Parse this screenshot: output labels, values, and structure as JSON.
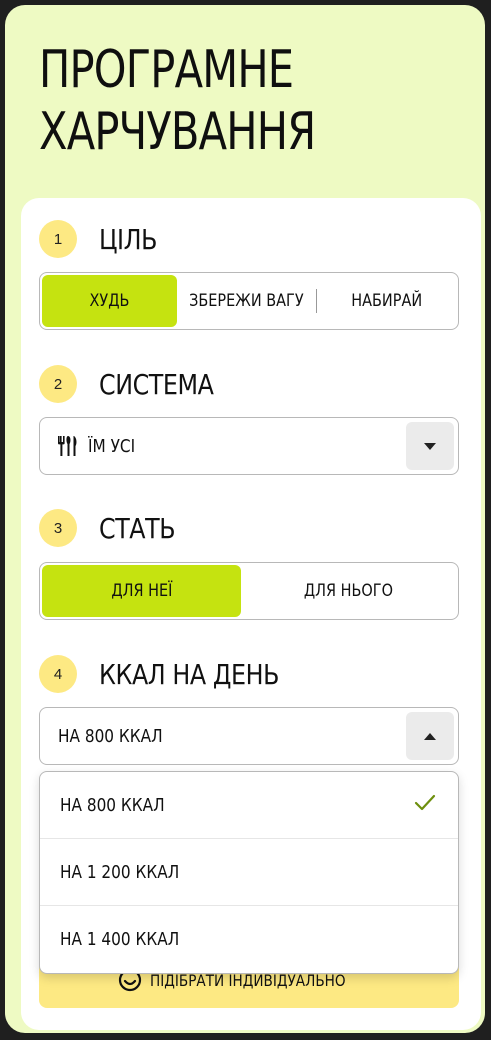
{
  "title_line1": "ПРОГРАМНЕ",
  "title_line2": "ХАРЧУВАННЯ",
  "colors": {
    "accent": "#c5e310",
    "step_badge": "#fde983",
    "background": "#eefac3"
  },
  "steps": [
    {
      "number": "1",
      "title": "ЦІЛЬ"
    },
    {
      "number": "2",
      "title": "СИСТЕМА"
    },
    {
      "number": "3",
      "title": "СТАТЬ"
    },
    {
      "number": "4",
      "title": "ККАЛ НА ДЕНЬ"
    }
  ],
  "goal": {
    "options": [
      "ХУДЬ",
      "ЗБЕРЕЖИ ВАГУ",
      "НАБИРАЙ"
    ],
    "selected": "ХУДЬ"
  },
  "system": {
    "value": "ЇМ УСІ",
    "icon": "cutlery-icon"
  },
  "gender": {
    "options": [
      "ДЛЯ НЕЇ",
      "ДЛЯ НЬОГО"
    ],
    "selected": "ДЛЯ НЕЇ"
  },
  "kcal": {
    "value": "НА 800 ККАЛ",
    "options": [
      "НА 800 ККАЛ",
      "НА 1 200 ККАЛ",
      "НА 1 400 ККАЛ"
    ],
    "selected": "НА 800 ККАЛ"
  },
  "cta": {
    "label": "ПІДІБРАТИ ІНДИВІДУАЛЬНО",
    "icon": "smile-icon"
  }
}
